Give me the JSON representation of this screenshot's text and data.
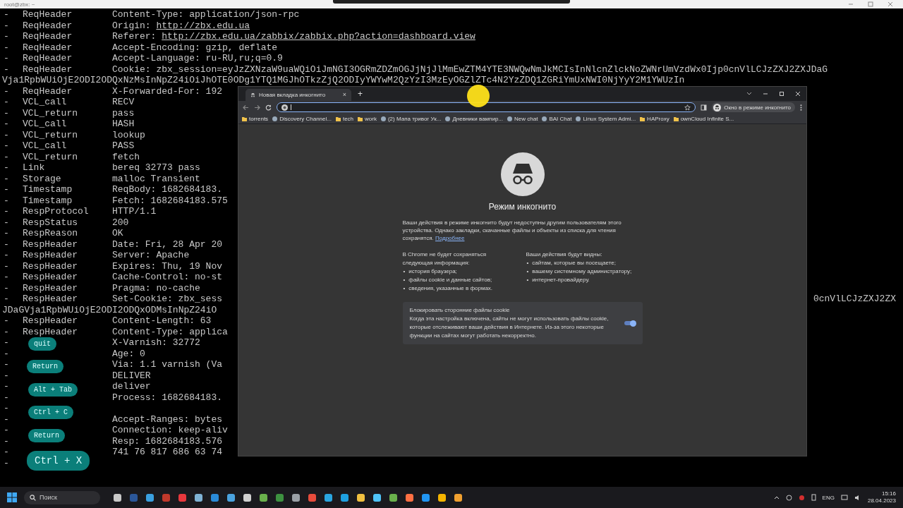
{
  "terminal": {
    "title": "root@zbx: ~",
    "lines": [
      {
        "kind": "entry",
        "dash": "-",
        "tag": "ReqHeader",
        "value": "Content-Type: application/json-rpc"
      },
      {
        "kind": "entry",
        "dash": "-",
        "tag": "ReqHeader",
        "value": "Origin: ",
        "link": "http://zbx.edu.ua"
      },
      {
        "kind": "entry",
        "dash": "-",
        "tag": "ReqHeader",
        "value": "Referer: ",
        "link": "http://zbx.edu.ua/zabbix/zabbix.php?action=dashboard.view"
      },
      {
        "kind": "entry",
        "dash": "-",
        "tag": "ReqHeader",
        "value": "Accept-Encoding: gzip, deflate"
      },
      {
        "kind": "entry",
        "dash": "-",
        "tag": "ReqHeader",
        "value": "Accept-Language: ru-RU,ru;q=0.9"
      },
      {
        "kind": "entry",
        "dash": "-",
        "tag": "ReqHeader",
        "value": "Cookie: zbx_session=eyJzZXNzaW9uaWQiOiJmNGI3OGRmZDZmOGJjNjJlMmEwZTM4YTE3NWQwNmJkMCIsInNlcnZlckNoZWNrUmVzdWx0Ijp0cnVlLCJzZXJ2ZXJDaG"
      },
      {
        "kind": "wrap",
        "value": "Vja1RpbWUiOjE2ODI2ODQxNzMsInNpZ24iOiJhOTE0ODg1YTQ1MGJhOTkzZjQ2ODIyYWYwM2QzYzI3MzEyOGZlZTc4N2YzZDQ1ZGRiYmUxNWI0NjYyY2M1YWUzIn"
      },
      {
        "kind": "entry",
        "dash": "-",
        "tag": "ReqHeader",
        "value": "X-Forwarded-For: 192"
      },
      {
        "kind": "entry",
        "dash": "-",
        "tag": "VCL_call",
        "value": "RECV"
      },
      {
        "kind": "entry",
        "dash": "-",
        "tag": "VCL_return",
        "value": "pass"
      },
      {
        "kind": "entry",
        "dash": "-",
        "tag": "VCL_call",
        "value": "HASH"
      },
      {
        "kind": "entry",
        "dash": "-",
        "tag": "VCL_return",
        "value": "lookup"
      },
      {
        "kind": "entry",
        "dash": "-",
        "tag": "VCL_call",
        "value": "PASS"
      },
      {
        "kind": "entry",
        "dash": "-",
        "tag": "VCL_return",
        "value": "fetch"
      },
      {
        "kind": "entry",
        "dash": "-",
        "tag": "Link",
        "value": "bereq 32773 pass"
      },
      {
        "kind": "entry",
        "dash": "-",
        "tag": "Storage",
        "value": "malloc Transient"
      },
      {
        "kind": "entry",
        "dash": "-",
        "tag": "Timestamp",
        "value": "ReqBody: 1682684183."
      },
      {
        "kind": "entry",
        "dash": "-",
        "tag": "Timestamp",
        "value": "Fetch: 1682684183.575"
      },
      {
        "kind": "entry",
        "dash": "-",
        "tag": "RespProtocol",
        "value": "HTTP/1.1"
      },
      {
        "kind": "entry",
        "dash": "-",
        "tag": "RespStatus",
        "value": "200"
      },
      {
        "kind": "entry",
        "dash": "-",
        "tag": "RespReason",
        "value": "OK"
      },
      {
        "kind": "entry",
        "dash": "-",
        "tag": "RespHeader",
        "value": "Date: Fri, 28 Apr 20"
      },
      {
        "kind": "entry",
        "dash": "-",
        "tag": "RespHeader",
        "value": "Server: Apache"
      },
      {
        "kind": "entry",
        "dash": "-",
        "tag": "RespHeader",
        "value": "Expires: Thu, 19 Nov"
      },
      {
        "kind": "entry",
        "dash": "-",
        "tag": "RespHeader",
        "value": "Cache-Control: no-st"
      },
      {
        "kind": "entry",
        "dash": "-",
        "tag": "RespHeader",
        "value": "Pragma: no-cache"
      },
      {
        "kind": "entry",
        "dash": "-",
        "tag": "RespHeader",
        "value": "Set-Cookie: zbx_sess",
        "tail": "0cnVlLCJzZXJ2ZX"
      },
      {
        "kind": "wrap",
        "value": "JDaGVja1RpbWUiOjE2ODI2ODQxODMsInNpZ24iO"
      },
      {
        "kind": "entry",
        "dash": "-",
        "tag": "RespHeader",
        "value": "Content-Length: 63"
      },
      {
        "kind": "entry",
        "dash": "-",
        "tag": "RespHeader",
        "value": "Content-Type: applica"
      },
      {
        "kind": "entry",
        "dash": "-",
        "value": "X-Varnish: 32772"
      },
      {
        "kind": "entry",
        "dash": "-",
        "value": "Age: 0"
      },
      {
        "kind": "entry",
        "dash": "-",
        "value": "Via: 1.1 varnish (Va"
      },
      {
        "kind": "entry",
        "dash": "-",
        "value": "DELIVER"
      },
      {
        "kind": "entry",
        "dash": "-",
        "value": "deliver"
      },
      {
        "kind": "entry",
        "dash": "-",
        "value": "Process: 1682684183."
      },
      {
        "kind": "entry",
        "dash": "-"
      },
      {
        "kind": "entry",
        "dash": "-",
        "value": "Accept-Ranges: bytes"
      },
      {
        "kind": "entry",
        "dash": "-",
        "value": "Connection: keep-aliv"
      },
      {
        "kind": "entry",
        "dash": "-",
        "value": "Resp: 1682684183.576"
      },
      {
        "kind": "entry",
        "dash": "-",
        "value": "741 76 817 686 63 74"
      },
      {
        "kind": "entry",
        "dash": "-"
      }
    ]
  },
  "browser": {
    "tab_title": "Новая вкладка инкогнито",
    "tab_close": "×",
    "new_tab": "+",
    "profile_label": "Окно в режиме инкогнито",
    "bookmarks": [
      {
        "label": "torrents",
        "kind": "folder"
      },
      {
        "label": "Discovery Channel...",
        "kind": "site"
      },
      {
        "label": "tech",
        "kind": "folder"
      },
      {
        "label": "work",
        "kind": "folder"
      },
      {
        "label": "(2) Мапа тривог Ук...",
        "kind": "site"
      },
      {
        "label": "Дневники вампир...",
        "kind": "site"
      },
      {
        "label": "New chat",
        "kind": "site"
      },
      {
        "label": "BAI Chat",
        "kind": "site"
      },
      {
        "label": "Linux System Admi...",
        "kind": "site"
      },
      {
        "label": "HAProxy",
        "kind": "folder"
      },
      {
        "label": "ownCloud Infinite S...",
        "kind": "folder"
      }
    ],
    "page": {
      "title": "Режим инкогнито",
      "intro": "Ваши действия в режиме инкогнито будут недоступны другим пользователям этого устройства. Однако закладки, скачанные файлы и объекты из списка для чтения сохранятся.",
      "intro_link": "Подробнее",
      "not_saved": {
        "heading": "В Chrome не будет сохраняться следующая информация:",
        "items": [
          {
            "bullet": "•",
            "text": "история браузера;"
          },
          {
            "bullet": "•",
            "text": "файлы cookie и данные сайтов;"
          },
          {
            "bullet": "•",
            "text": "сведения, указанные в формах."
          }
        ]
      },
      "visible": {
        "heading": "Ваши действия будут видны:",
        "items": [
          {
            "bullet": "•",
            "text": "сайтам, которые вы посещаете;"
          },
          {
            "bullet": "•",
            "text": "вашему системному администратору;"
          },
          {
            "bullet": "•",
            "text": "интернет-провайдеру."
          }
        ]
      },
      "cookie_card": {
        "title": "Блокировать сторонние файлы cookie",
        "text": "Когда эта настройка включена, сайты не могут использовать файлы cookie, которые отслеживают ваши действия в Интернете. Из-за этого некоторые функции на сайтах могут работать некорректно.",
        "on": true
      }
    }
  },
  "key_overlays": [
    {
      "label": "quit",
      "kind": "small"
    },
    {
      "label": "Return",
      "kind": "small"
    },
    {
      "label": "Alt + Tab",
      "kind": "small"
    },
    {
      "label": "Ctrl + C",
      "kind": "small"
    },
    {
      "label": "Return",
      "kind": "small"
    },
    {
      "label": "Ctrl + X",
      "kind": "large"
    }
  ],
  "taskbar": {
    "search_placeholder": "Поиск",
    "language": "ENG",
    "time": "15:16",
    "date": "28.04.2023"
  }
}
